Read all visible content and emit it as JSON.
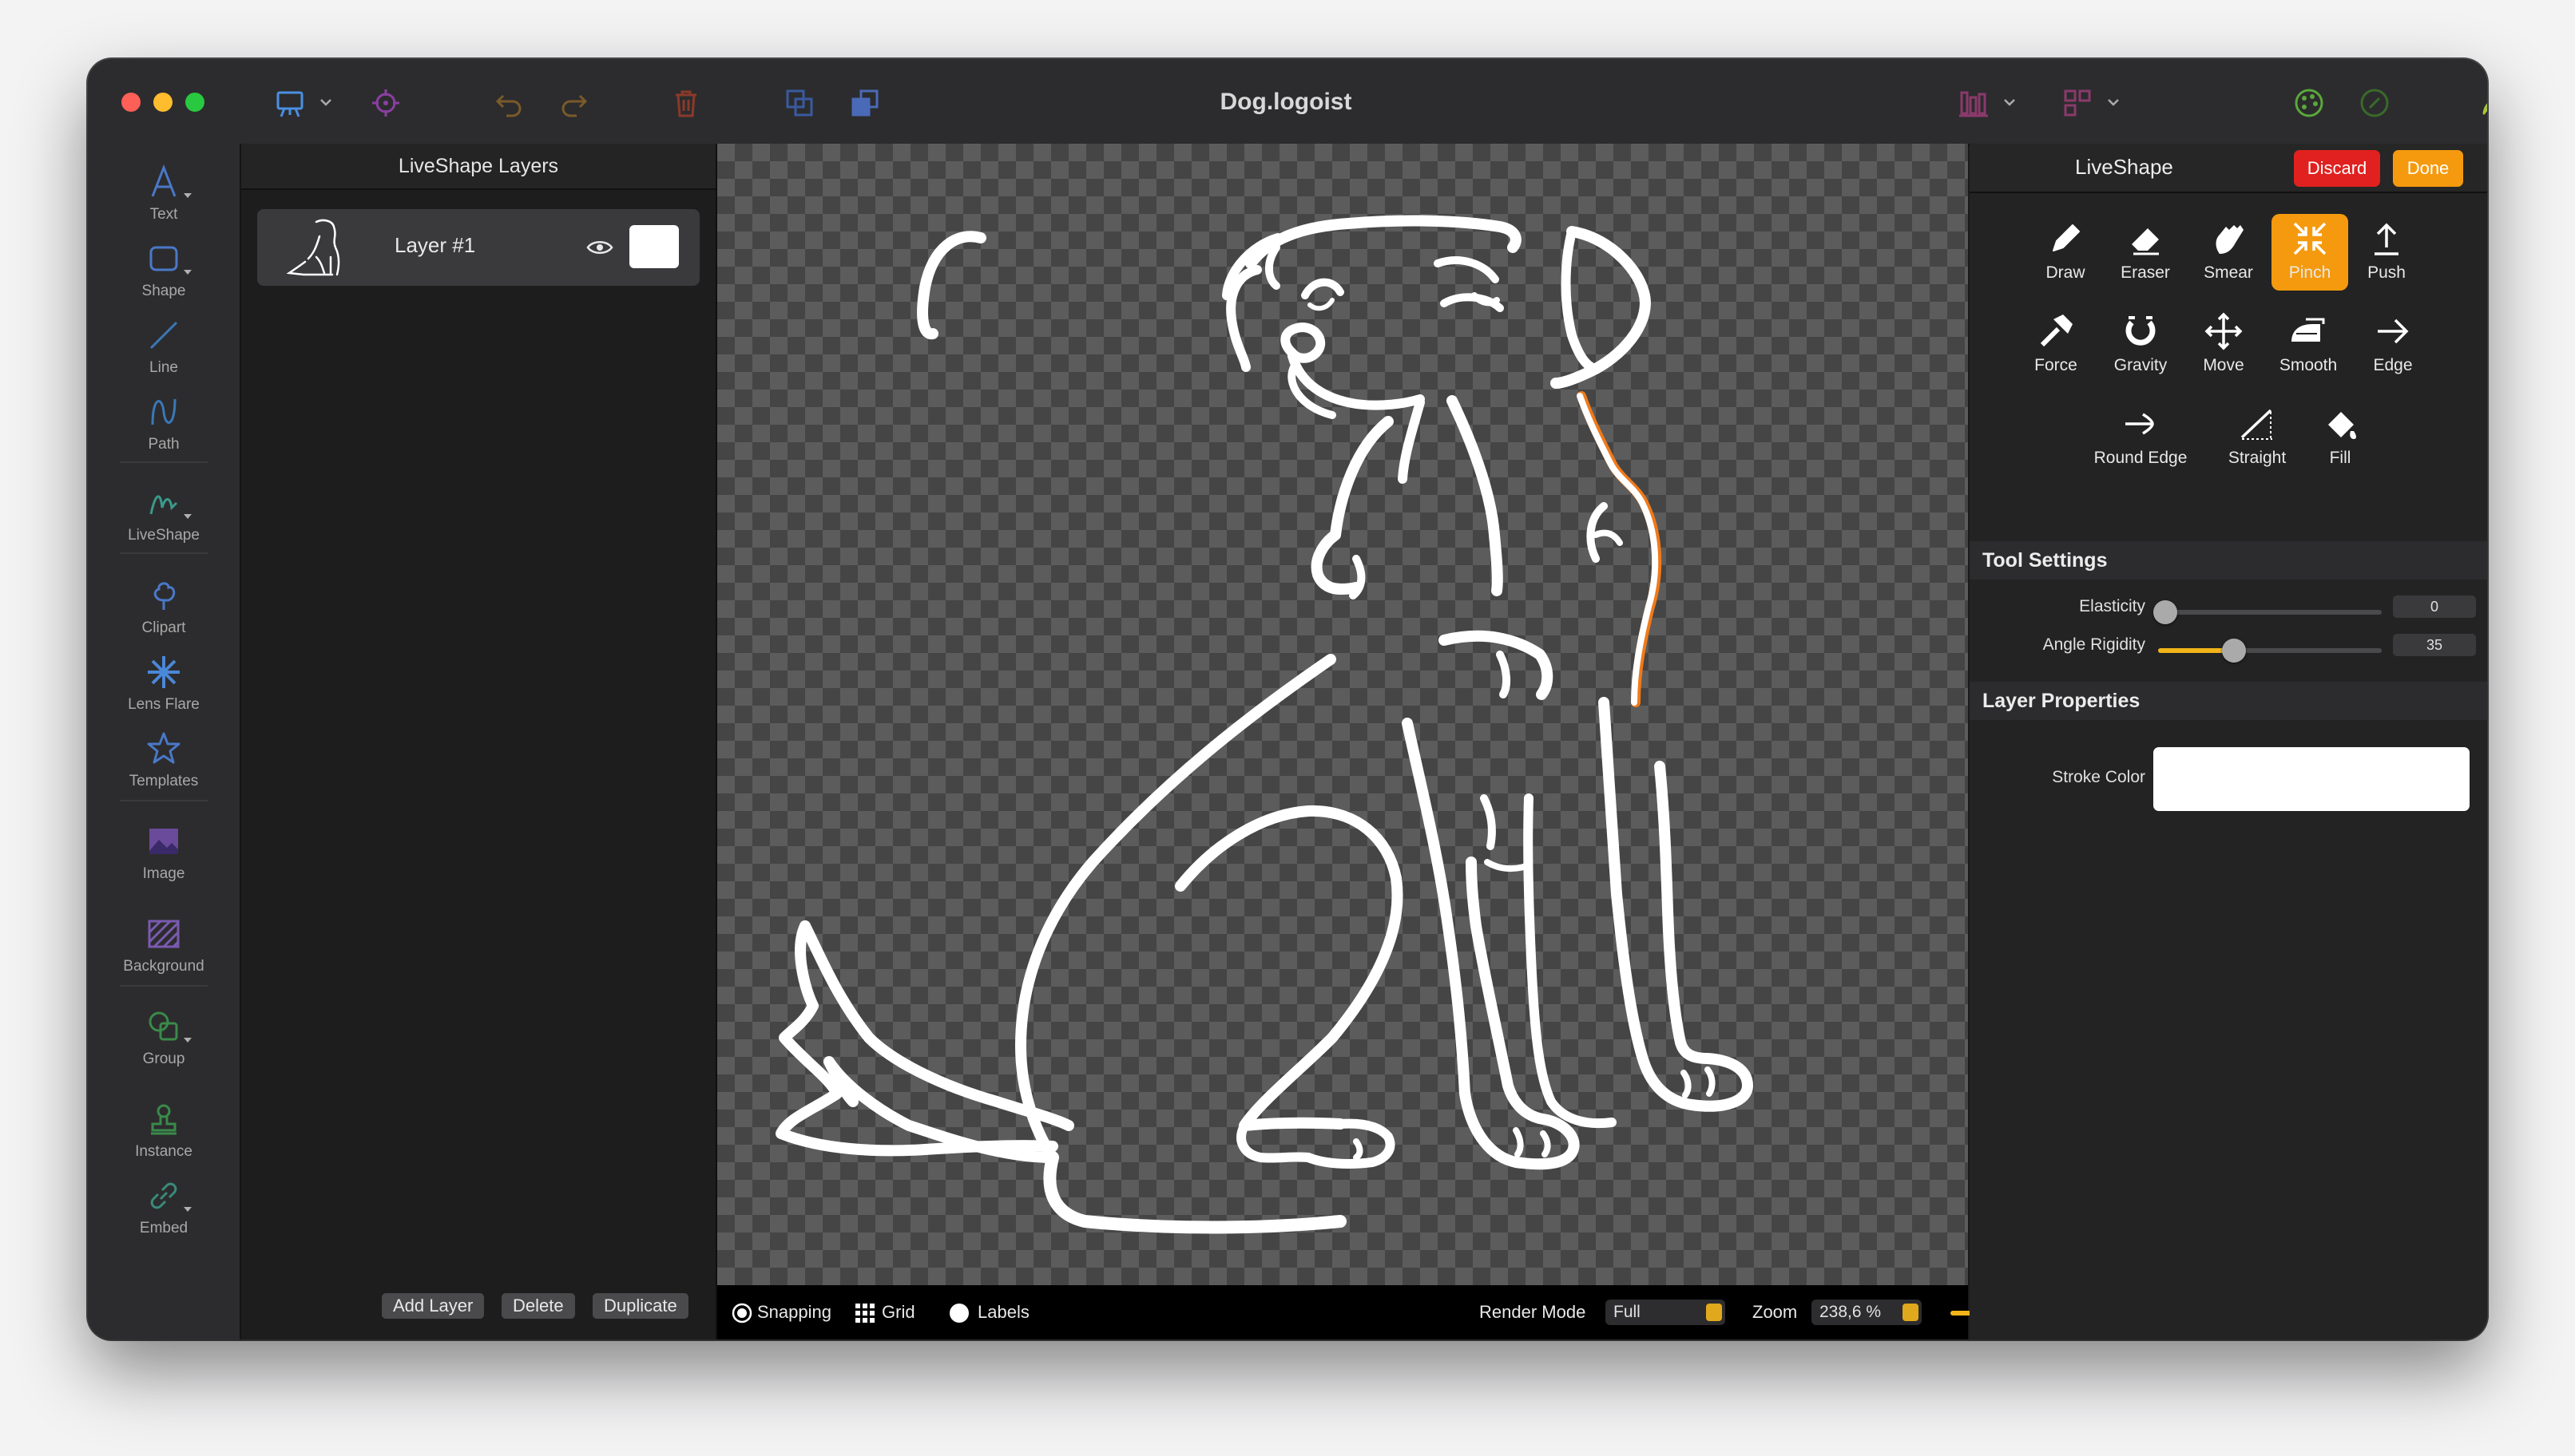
{
  "window": {
    "title": "Dog.logoist"
  },
  "toolbar_left": {
    "items": [
      {
        "label": "Text",
        "icon": "text-icon"
      },
      {
        "label": "Shape",
        "icon": "shape-icon"
      },
      {
        "label": "Line",
        "icon": "line-icon"
      },
      {
        "label": "Path",
        "icon": "path-icon"
      },
      {
        "label": "LiveShape",
        "icon": "liveshape-icon"
      },
      {
        "label": "Clipart",
        "icon": "clipart-icon"
      },
      {
        "label": "Lens Flare",
        "icon": "lens-flare-icon"
      },
      {
        "label": "Templates",
        "icon": "templates-icon"
      },
      {
        "label": "Image",
        "icon": "image-icon"
      },
      {
        "label": "Background",
        "icon": "background-icon"
      },
      {
        "label": "Group",
        "icon": "group-icon"
      },
      {
        "label": "Instance",
        "icon": "instance-icon"
      },
      {
        "label": "Embed",
        "icon": "embed-icon"
      }
    ]
  },
  "layers_panel": {
    "title": "LiveShape Layers",
    "layers": [
      {
        "name": "Layer #1",
        "color": "#ffffff"
      }
    ],
    "buttons": {
      "add": "Add Layer",
      "delete": "Delete",
      "duplicate": "Duplicate"
    }
  },
  "bottom_bar": {
    "snapping": "Snapping",
    "grid": "Grid",
    "labels": "Labels",
    "render_mode_label": "Render Mode",
    "render_mode_value": "Full",
    "zoom_label": "Zoom",
    "zoom_value": "238,6 %"
  },
  "inspector": {
    "title": "LiveShape",
    "discard": "Discard",
    "done": "Done",
    "tools": [
      {
        "label": "Draw",
        "icon": "pencil-icon"
      },
      {
        "label": "Eraser",
        "icon": "eraser-icon"
      },
      {
        "label": "Smear",
        "icon": "hand-icon"
      },
      {
        "label": "Pinch",
        "icon": "pinch-icon",
        "active": true
      },
      {
        "label": "Push",
        "icon": "push-icon"
      },
      {
        "label": "Force",
        "icon": "hammer-icon"
      },
      {
        "label": "Gravity",
        "icon": "magnet-icon"
      },
      {
        "label": "Move",
        "icon": "move-icon"
      },
      {
        "label": "Smooth",
        "icon": "iron-icon"
      },
      {
        "label": "Edge",
        "icon": "edge-icon"
      },
      {
        "label": "Round Edge",
        "icon": "round-edge-icon"
      },
      {
        "label": "Straight",
        "icon": "straight-icon"
      },
      {
        "label": "Fill",
        "icon": "fill-icon"
      }
    ],
    "tool_settings": {
      "title": "Tool Settings",
      "elasticity_label": "Elasticity",
      "elasticity_value": "0",
      "angle_rigidity_label": "Angle Rigidity",
      "angle_rigidity_value": "35"
    },
    "layer_properties": {
      "title": "Layer Properties",
      "stroke_color_label": "Stroke Color",
      "stroke_color": "#ffffff"
    }
  },
  "colors": {
    "accent": "#f59a0e",
    "discard": "#e0211f",
    "selection_stroke": "#f07a1a"
  }
}
